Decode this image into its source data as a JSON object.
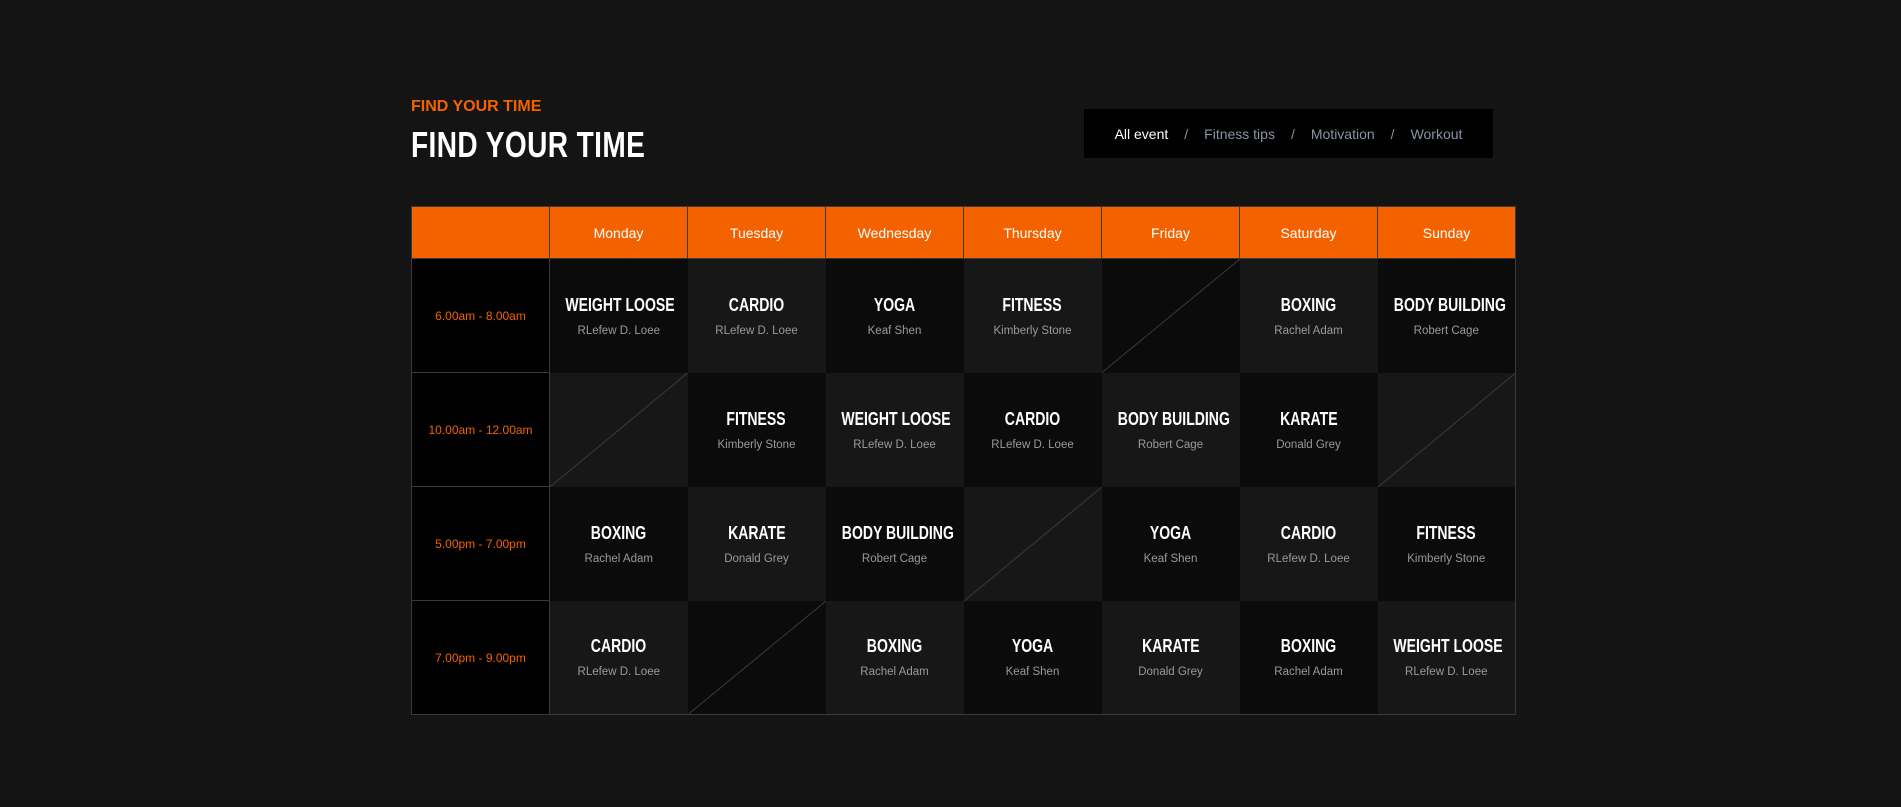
{
  "header": {
    "subtitle": "FIND YOUR TIME",
    "title": "FIND YOUR TIME"
  },
  "filters": [
    "All event",
    "Fitness tips",
    "Motivation",
    "Workout"
  ],
  "filter_active": "All event",
  "colors": {
    "accent": "#f46200",
    "background": "#141414"
  },
  "schedule": {
    "days": [
      "Monday",
      "Tuesday",
      "Wednesday",
      "Thursday",
      "Friday",
      "Saturday",
      "Sunday"
    ],
    "rows": [
      {
        "time": "6.00am - 8.00am",
        "cells": [
          {
            "event": "WEIGHT LOOSE",
            "trainer": "RLefew D. Loee"
          },
          {
            "event": "CARDIO",
            "trainer": "RLefew D. Loee"
          },
          {
            "event": "YOGA",
            "trainer": "Keaf Shen"
          },
          {
            "event": "FITNESS",
            "trainer": "Kimberly Stone"
          },
          null,
          {
            "event": "BOXING",
            "trainer": "Rachel Adam"
          },
          {
            "event": "BODY BUILDING",
            "trainer": "Robert Cage"
          }
        ]
      },
      {
        "time": "10.00am - 12.00am",
        "cells": [
          null,
          {
            "event": "FITNESS",
            "trainer": "Kimberly Stone"
          },
          {
            "event": "WEIGHT LOOSE",
            "trainer": "RLefew D. Loee"
          },
          {
            "event": "CARDIO",
            "trainer": "RLefew D. Loee"
          },
          {
            "event": "BODY BUILDING",
            "trainer": "Robert Cage"
          },
          {
            "event": "KARATE",
            "trainer": "Donald Grey"
          },
          null
        ]
      },
      {
        "time": "5.00pm - 7.00pm",
        "cells": [
          {
            "event": "BOXING",
            "trainer": "Rachel Adam"
          },
          {
            "event": "KARATE",
            "trainer": "Donald Grey"
          },
          {
            "event": "BODY BUILDING",
            "trainer": "Robert Cage"
          },
          null,
          {
            "event": "YOGA",
            "trainer": "Keaf Shen"
          },
          {
            "event": "CARDIO",
            "trainer": "RLefew D. Loee"
          },
          {
            "event": "FITNESS",
            "trainer": "Kimberly Stone"
          }
        ]
      },
      {
        "time": "7.00pm - 9.00pm",
        "cells": [
          {
            "event": "CARDIO",
            "trainer": "RLefew D. Loee"
          },
          null,
          {
            "event": "BOXING",
            "trainer": "Rachel Adam"
          },
          {
            "event": "YOGA",
            "trainer": "Keaf Shen"
          },
          {
            "event": "KARATE",
            "trainer": "Donald Grey"
          },
          {
            "event": "BOXING",
            "trainer": "Rachel Adam"
          },
          {
            "event": "WEIGHT LOOSE",
            "trainer": "RLefew D. Loee"
          }
        ]
      }
    ]
  }
}
